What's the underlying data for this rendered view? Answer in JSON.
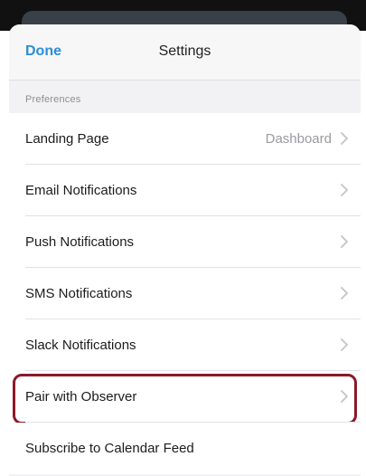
{
  "navbar": {
    "done_label": "Done",
    "title": "Settings"
  },
  "section": {
    "header": "Preferences"
  },
  "rows": [
    {
      "label": "Landing Page",
      "value": "Dashboard"
    },
    {
      "label": "Email Notifications"
    },
    {
      "label": "Push Notifications"
    },
    {
      "label": "SMS Notifications"
    },
    {
      "label": "Slack Notifications"
    },
    {
      "label": "Pair with Observer",
      "highlighted": true
    },
    {
      "label": "Subscribe to Calendar Feed"
    }
  ],
  "colors": {
    "accent": "#2a8fd6",
    "highlight_border": "#8b1a2a"
  },
  "icons": {
    "chevron": "chevron-right-icon"
  }
}
